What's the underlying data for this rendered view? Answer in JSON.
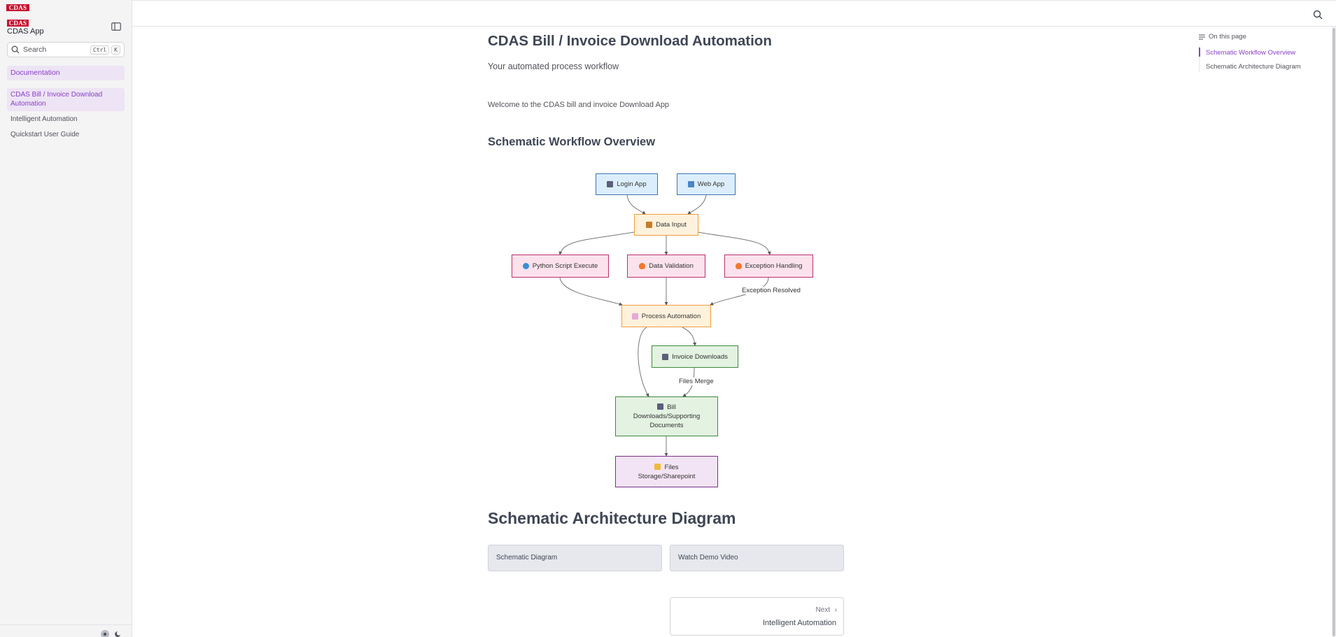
{
  "brand": {
    "logo_text": "CDAS",
    "app_name": "CDAS App"
  },
  "sidebar": {
    "search_placeholder": "Search",
    "shortcut_keys": [
      "Ctrl",
      "K"
    ],
    "section": "Documentation",
    "items": [
      {
        "label": "CDAS Bill / Invoice Download Automation",
        "active": true
      },
      {
        "label": "Intelligent Automation",
        "active": false
      },
      {
        "label": "Quickstart User Guide",
        "active": false
      }
    ]
  },
  "page": {
    "title": "CDAS Bill / Invoice Download Automation",
    "subtitle": "Your automated process workflow",
    "welcome": "Welcome to the CDAS bill and invoice Download App",
    "section1_heading": "Schematic Workflow Overview",
    "section2_heading": "Schematic Architecture Diagram"
  },
  "diagram": {
    "nodes": {
      "login_app": {
        "label": "Login App",
        "icon": "book-icon"
      },
      "web_app": {
        "label": "Web App",
        "icon": "globe-window-icon"
      },
      "data_input": {
        "label": "Data Input",
        "icon": "inbox-tray-icon"
      },
      "python_script": {
        "label": "Python Script Execute",
        "icon": "globe-icon"
      },
      "data_validation": {
        "label": "Data Validation",
        "icon": "flame-icon"
      },
      "exception_handling": {
        "label": "Exception Handling",
        "icon": "flame-icon"
      },
      "process_automation": {
        "label": "Process Automation",
        "icon": "chart-icon"
      },
      "invoice_downloads": {
        "label": "Invoice Downloads",
        "icon": "book-icon"
      },
      "bill_downloads_line1": {
        "label": "Bill",
        "icon": "book-icon"
      },
      "bill_downloads_line2": {
        "label": "Downloads/Supporting"
      },
      "bill_downloads_line3": {
        "label": "Documents"
      },
      "files_storage_line1": {
        "label": "Files",
        "icon": "folder-icon"
      },
      "files_storage_line2": {
        "label": "Storage/Sharepoint"
      }
    },
    "edge_labels": {
      "exception_resolved": "Exception Resolved",
      "files_merge": "Files Merge"
    }
  },
  "actions": {
    "schematic_diagram": "Schematic Diagram",
    "watch_demo": "Watch Demo Video"
  },
  "pager": {
    "next_label": "Next",
    "next_title": "Intelligent Automation"
  },
  "toc": {
    "heading": "On this page",
    "items": [
      {
        "label": "Schematic Workflow Overview",
        "active": true
      },
      {
        "label": "Schematic Architecture Diagram",
        "active": false
      }
    ]
  },
  "colors": {
    "accent": "#8a3fc7",
    "logo_red": "#c8102e",
    "node_blue": "#3b73b5",
    "node_orange": "#f09c3a",
    "node_pink": "#b9316d",
    "node_green": "#3f8a3f",
    "node_purple": "#7b2e8c"
  }
}
